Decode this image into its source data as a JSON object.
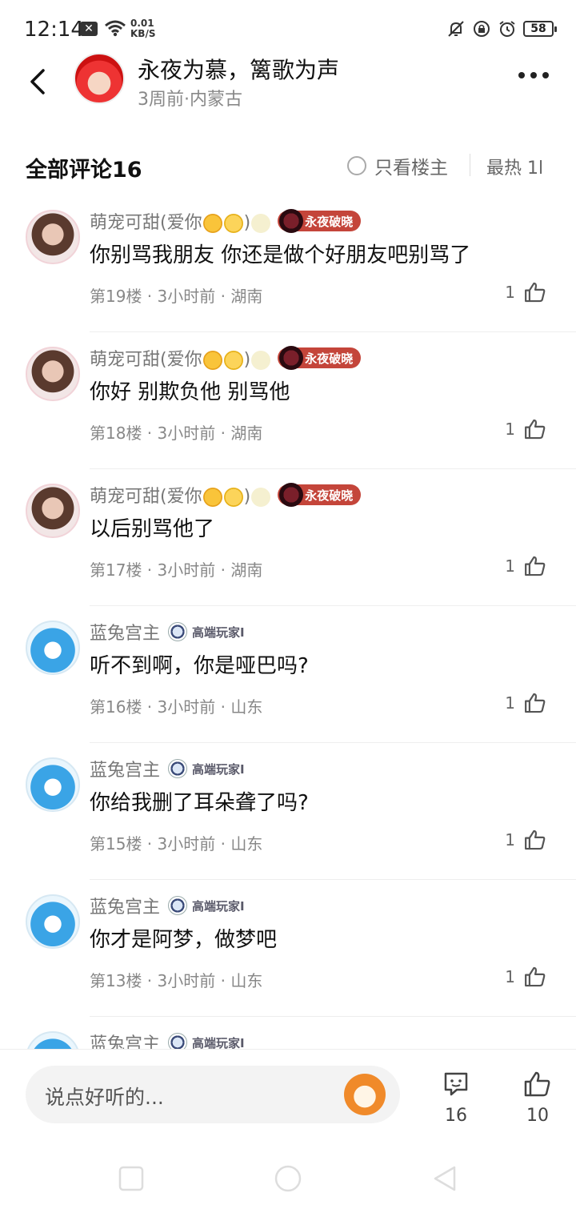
{
  "status": {
    "time": "12:14",
    "speed_top": "0.01",
    "speed_bottom": "KB/S",
    "battery": "58",
    "icons": [
      "close-notification-icon",
      "wifi-icon",
      "bell-off-icon",
      "rotation-lock-icon",
      "alarm-icon",
      "battery-icon"
    ]
  },
  "header": {
    "author_name": "永夜为慕，篱歌为声",
    "author_meta": "3周前·内蒙古"
  },
  "filter": {
    "all_comments": "全部评论16",
    "only_op": "只看楼主",
    "sort": "最热 1l"
  },
  "comments": [
    {
      "user": "萌宠可甜(爱你",
      "user_suffix": ")",
      "badge": "永夜破晓",
      "badge_type": "red",
      "avatar": "girl",
      "text": "你别骂我朋友 你还是做个好朋友吧别骂了",
      "meta": "第19楼 · 3小时前 · 湖南",
      "likes": "1"
    },
    {
      "user": "萌宠可甜(爱你",
      "user_suffix": ")",
      "badge": "永夜破晓",
      "badge_type": "red",
      "avatar": "girl",
      "text": "你好 别欺负他 别骂他",
      "meta": "第18楼 · 3小时前 · 湖南",
      "likes": "1"
    },
    {
      "user": "萌宠可甜(爱你",
      "user_suffix": ")",
      "badge": "永夜破晓",
      "badge_type": "red",
      "avatar": "girl",
      "text": "以后别骂他了",
      "meta": "第17楼 · 3小时前 · 湖南",
      "likes": "1"
    },
    {
      "user": "蓝兔宫主",
      "user_suffix": "",
      "badge": "高端玩家I",
      "badge_type": "blue",
      "avatar": "rabbit",
      "text": "听不到啊，你是哑巴吗?",
      "meta": "第16楼 · 3小时前 · 山东",
      "likes": "1"
    },
    {
      "user": "蓝兔宫主",
      "user_suffix": "",
      "badge": "高端玩家I",
      "badge_type": "blue",
      "avatar": "rabbit",
      "text": "你给我删了耳朵聋了吗?",
      "meta": "第15楼 · 3小时前 · 山东",
      "likes": "1"
    },
    {
      "user": "蓝兔宫主",
      "user_suffix": "",
      "badge": "高端玩家I",
      "badge_type": "blue",
      "avatar": "rabbit",
      "text": "你才是阿梦，做梦吧",
      "meta": "第13楼 · 3小时前 · 山东",
      "likes": "1"
    },
    {
      "user": "蓝兔宫主",
      "user_suffix": "",
      "badge": "高端玩家I",
      "badge_type": "blue",
      "avatar": "rabbit",
      "text": "",
      "meta": "",
      "likes": ""
    }
  ],
  "bottom": {
    "input_placeholder": "说点好听的...",
    "comment_count": "16",
    "like_count": "10"
  },
  "colors": {
    "badge_red": "#c4453a",
    "text_primary": "#111111",
    "text_secondary": "#888888"
  }
}
